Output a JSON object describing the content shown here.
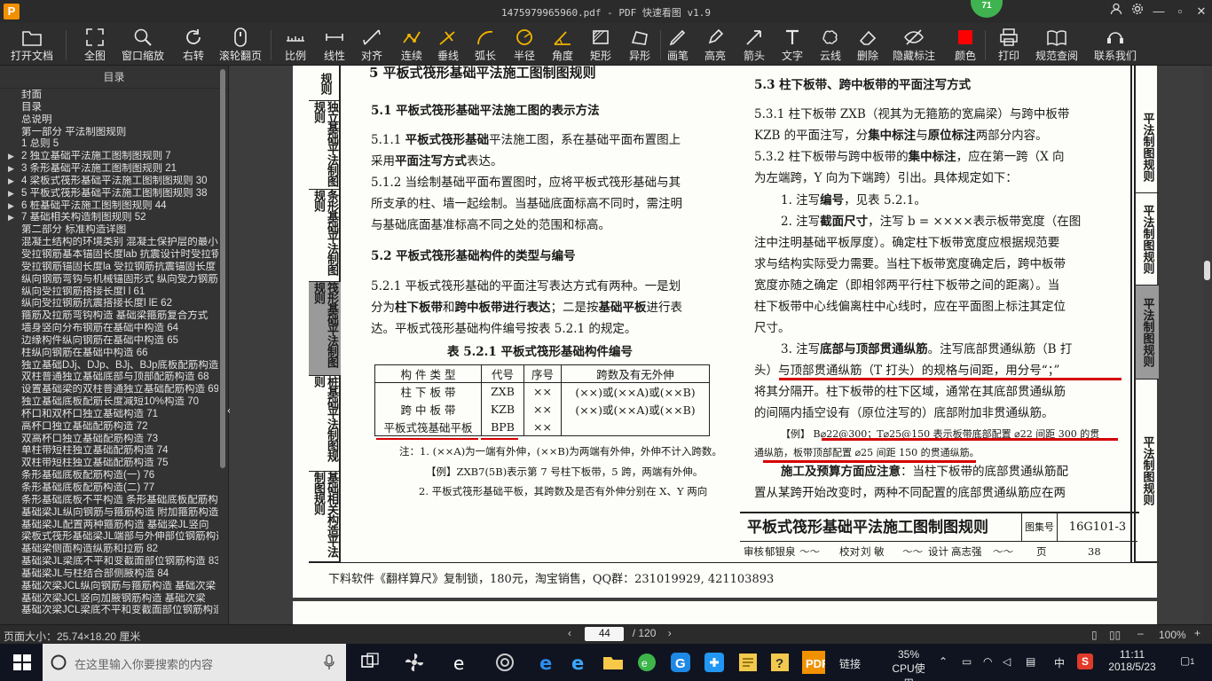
{
  "app": {
    "title": "1475979965960.pdf - PDF 快速看图 v1.9",
    "badge": "71",
    "accent": "#f29100"
  },
  "toolbar": [
    {
      "label": "打开文档",
      "icon": "folder-icon"
    },
    {
      "label": "全图",
      "icon": "fullview-icon"
    },
    {
      "label": "窗口缩放",
      "icon": "zoom-window-icon"
    },
    {
      "label": "右转",
      "icon": "rotate-right-icon"
    },
    {
      "label": "滚轮翻页",
      "icon": "mouse-wheel-icon"
    },
    {
      "label": "比例",
      "icon": "scale-icon"
    },
    {
      "label": "线性",
      "icon": "linear-icon"
    },
    {
      "label": "对齐",
      "icon": "align-icon"
    },
    {
      "label": "连续",
      "icon": "continuous-icon"
    },
    {
      "label": "垂线",
      "icon": "perpendicular-icon"
    },
    {
      "label": "弧长",
      "icon": "arc-length-icon"
    },
    {
      "label": "半径",
      "icon": "radius-icon"
    },
    {
      "label": "角度",
      "icon": "angle-icon"
    },
    {
      "label": "矩形",
      "icon": "rectangle-icon"
    },
    {
      "label": "异形",
      "icon": "irregular-shape-icon"
    },
    {
      "label": "画笔",
      "icon": "pen-icon"
    },
    {
      "label": "高亮",
      "icon": "highlight-icon"
    },
    {
      "label": "箭头",
      "icon": "arrow-icon"
    },
    {
      "label": "文字",
      "icon": "text-icon"
    },
    {
      "label": "云线",
      "icon": "cloud-line-icon"
    },
    {
      "label": "删除",
      "icon": "eraser-icon"
    },
    {
      "label": "隐藏标注",
      "icon": "hide-markup-icon"
    },
    {
      "label": "颜色",
      "icon": "color-swatch-icon",
      "color": "#ff0000"
    },
    {
      "label": "打印",
      "icon": "printer-icon"
    },
    {
      "label": "规范查阅",
      "icon": "book-icon"
    },
    {
      "label": "联系我们",
      "icon": "support-icon"
    }
  ],
  "sidebar": {
    "title": "目录",
    "items": [
      {
        "text": "封面"
      },
      {
        "text": "目录"
      },
      {
        "text": "总说明"
      },
      {
        "text": "第一部分  平法制图规则"
      },
      {
        "text": "1  总则 5"
      },
      {
        "text": "2  独立基础平法施工图制图规则 7",
        "arrow": true
      },
      {
        "text": "3  条形基础平法施工图制图规则 21",
        "arrow": true
      },
      {
        "text": "4  梁板式筏形基础平法施工图制图规则 30",
        "arrow": true
      },
      {
        "text": "5  平板式筏形基础平法施工图制图规则 38",
        "arrow": true
      },
      {
        "text": "6  桩基础平法施工图制图规则 44",
        "arrow": true
      },
      {
        "text": "7  基础相关构造制图规则 52",
        "arrow": true
      },
      {
        "text": "第二部分  标准构造详图"
      },
      {
        "text": "混凝土结构的环境类别  混凝土保护层的最小厚度"
      },
      {
        "text": "受拉钢筋基本锚固长度lab 抗震设计时受拉钢筋"
      },
      {
        "text": "受拉钢筋锚固长度la 受拉钢筋抗震锚固长度"
      },
      {
        "text": "纵向钢筋弯钩与机械锚固形式 纵向受力钢筋"
      },
      {
        "text": "纵向受拉钢筋搭接长度l l 61"
      },
      {
        "text": "纵向受拉钢筋抗震搭接长度l lE 62"
      },
      {
        "text": "箍筋及拉筋弯钩构造 基础梁箍筋复合方式"
      },
      {
        "text": "墙身竖向分布钢筋在基础中构造 64"
      },
      {
        "text": "边缘构件纵向钢筋在基础中构造 65"
      },
      {
        "text": "柱纵向钢筋在基础中构造 66"
      },
      {
        "text": "独立基础DJj、DJp、BJj、BJp底板配筋构造"
      },
      {
        "text": "双柱普通独立基础底部与顶部配筋构造 68"
      },
      {
        "text": "设置基础梁的双柱普通独立基础配筋构造 69"
      },
      {
        "text": "独立基础底板配筋长度减短10%构造 70"
      },
      {
        "text": "杯口和双杯口独立基础构造 71"
      },
      {
        "text": "高杯口独立基础配筋构造 72"
      },
      {
        "text": "双高杯口独立基础配筋构造 73"
      },
      {
        "text": "单柱带短柱独立基础配筋构造 74"
      },
      {
        "text": "双柱带短柱独立基础配筋构造 75"
      },
      {
        "text": "条形基础底板配筋构造(一) 76"
      },
      {
        "text": "条形基础底板配筋构造(二) 77"
      },
      {
        "text": "条形基础底板不平构造 条形基础底板配筋构造"
      },
      {
        "text": "基础梁JL纵向钢筋与箍筋构造 附加箍筋构造"
      },
      {
        "text": "基础梁JL配置两种箍筋构造 基础梁JL竖向"
      },
      {
        "text": "梁板式筏形基础梁JL端部与外伸部位钢筋构造"
      },
      {
        "text": "基础梁侧面构造纵筋和拉筋 82"
      },
      {
        "text": "基础梁JL梁底不平和变截面部位钢筋构造 83"
      },
      {
        "text": "基础梁JL与柱结合部侧腋构造 84"
      },
      {
        "text": "基础次梁JCL纵向钢筋与箍筋构造 基础次梁"
      },
      {
        "text": "基础次梁JCL竖向加腋钢筋构造 基础次梁"
      },
      {
        "text": "基础次梁JCL梁底不平和变截面部位钢筋构造"
      }
    ]
  },
  "document": {
    "left_tabs": [
      "规则",
      "独立基础平法制图规则",
      "条形基础平法制图规则",
      "筏形基础平法制图规则",
      "桩基础平法制图规则",
      "基础相关构造平法制图规则"
    ],
    "right_tabs": [
      "平法制图规则",
      "平法制图规则",
      "平法制图规则",
      "平法制图规则"
    ],
    "section_title": "5  平板式筏形基础平法施工图制图规则",
    "s51_title": "5.1  平板式筏形基础平法施工图的表示方法",
    "s511_a": "5.1.1  ",
    "s511_b": "平板式筏形基础",
    "s511_c": "平法施工图，系在基础平面布置图上",
    "s511_d": "采用",
    "s511_e": "平面注写方式",
    "s511_f": "表达。",
    "s512_l1": "5.1.2  当绘制基础平面布置图时，应将平板式筏形基础与其",
    "s512_l2": "所支承的柱、墙一起绘制。当基础底面标高不同时，需注明",
    "s512_l3": "与基础底面基准标高不同之处的范围和标高。",
    "s52_title": "5.2  平板式筏形基础构件的类型与编号",
    "s521_l1": "5.2.1  平板式筏形基础的平面注写表达方式有两种。一是划",
    "s521_l2a": "分为",
    "s521_l2b": "柱下板带",
    "s521_l2c": "和",
    "s521_l2d": "跨中板带进行表达",
    "s521_l2e": "；二是按",
    "s521_l2f": "基础平板",
    "s521_l2g": "进行表",
    "s521_l3": "达。平板式筏形基础构件编号按表 5.2.1 的规定。",
    "table_title": "表 5.2.1    平板式筏形基础构件编号",
    "table_headers": [
      "构 件 类 型",
      "代号",
      "序号",
      "跨数及有无外伸"
    ],
    "table_rows": [
      [
        "柱 下 板 带",
        "ZXB",
        "××",
        "(××)或(××A)或(××B)"
      ],
      [
        "跨 中 板 带",
        "KZB",
        "××",
        "(××)或(××A)或(××B)"
      ],
      [
        "平板式筏基础平板",
        "BPB",
        "××",
        ""
      ]
    ],
    "note1": "注：1. (××A)为一端有外伸，(××B)为两端有外伸，外伸不计入跨数。",
    "note2": "【例】ZXB7(5B)表示第 7 号柱下板带，5 跨，两端有外伸。",
    "note3": "2. 平板式筏形基础平板，其跨数及是否有外伸分别在 X、Y 两向",
    "s53_title": "5.3  柱下板带、跨中板带的平面注写方式",
    "s531_l1": "5.3.1  柱下板带 ZXB（视其为无箍筋的宽扁梁）与跨中板带",
    "s531_l2a": "KZB 的平面注写，分",
    "s531_l2b": "集中标注",
    "s531_l2c": "与",
    "s531_l2d": "原位标注",
    "s531_l2e": "两部分内容。",
    "s532_l1a": "5.3.2  柱下板带与跨中板带的",
    "s532_l1b": "集中标注",
    "s532_l1c": "，应在第一跨（X 向",
    "s532_l2": "为左端跨，Y 向为下端跨）引出。具体规定如下：",
    "s532_i1a": "1. 注写",
    "s532_i1b": "编号",
    "s532_i1c": "，见表 5.2.1。",
    "s532_i2a": "2. 注写",
    "s532_i2b": "截面尺寸",
    "s532_i2c": "，注写 b = ××××表示板带宽度（在图",
    "s532_l5": "注中注明基础平板厚度）。确定柱下板带宽度应根据规范要",
    "s532_l6": "求与结构实际受力需要。当柱下板带宽度确定后，跨中板带",
    "s532_l7": "宽度亦随之确定（即相邻两平行柱下板带之间的距离）。当",
    "s532_l8": "柱下板带中心线偏离柱中心线时，应在平面图上标注其定位",
    "s532_l9": "尺寸。",
    "s532_i3a": "3. 注写",
    "s532_i3b": "底部与顶部贯通纵筋",
    "s532_i3c": "。注写底部贯通纵筋（B 打",
    "s532_l11": "头）与顶部贯通纵筋（T 打头）的规格与间距，用分号“；”",
    "s532_l12": "将其分隔开。柱下板带的柱下区域，通常在其底部贯通纵筋",
    "s532_l13": "的间隔内插空设有（原位注写的）底部附加非贯通纵筋。",
    "example_l1": "【例】 B⌀22@300；T⌀25@150 表示板带底部配置 ⌀22 间距 300 的贯",
    "example_l2": "通纵筋，板带顶部配置 ⌀25 间距 150 的贯通纵筋。",
    "s532_l16a": "施工及预算方面应注意",
    "s532_l16b": "：当柱下板带的底部贯通纵筋配",
    "s532_l17": "置从某跨开始改变时，两种不同配置的底部贯通纵筋应在两",
    "footer_title": "平板式筏形基础平法施工图制图规则",
    "footer_atlas_label": "图集号",
    "footer_atlas_no": "16G101-3",
    "footer_review": "审核",
    "footer_reviewer": "郁银泉",
    "footer_check": "校对",
    "footer_checker": "刘  敏",
    "footer_design": "设计",
    "footer_designer": "高志强",
    "footer_page_label": "页",
    "footer_page": "38",
    "download_text": "下料软件《翻样算尺》复制锁，180元，淘宝销售，QQ群：231019929, 421103893"
  },
  "statusbar": {
    "page_size": "页面大小：25.74×18.20 厘米",
    "current_page": "44",
    "total_pages": "/ 120",
    "zoom": "100%"
  },
  "taskbar": {
    "search_placeholder": "在这里输入你要搜索的内容",
    "link_label": "链接",
    "cpu_percent": "35%",
    "cpu_label": "CPU使用",
    "ime": "中",
    "time": "11:11",
    "date": "2018/5/23",
    "notifications": "1"
  }
}
